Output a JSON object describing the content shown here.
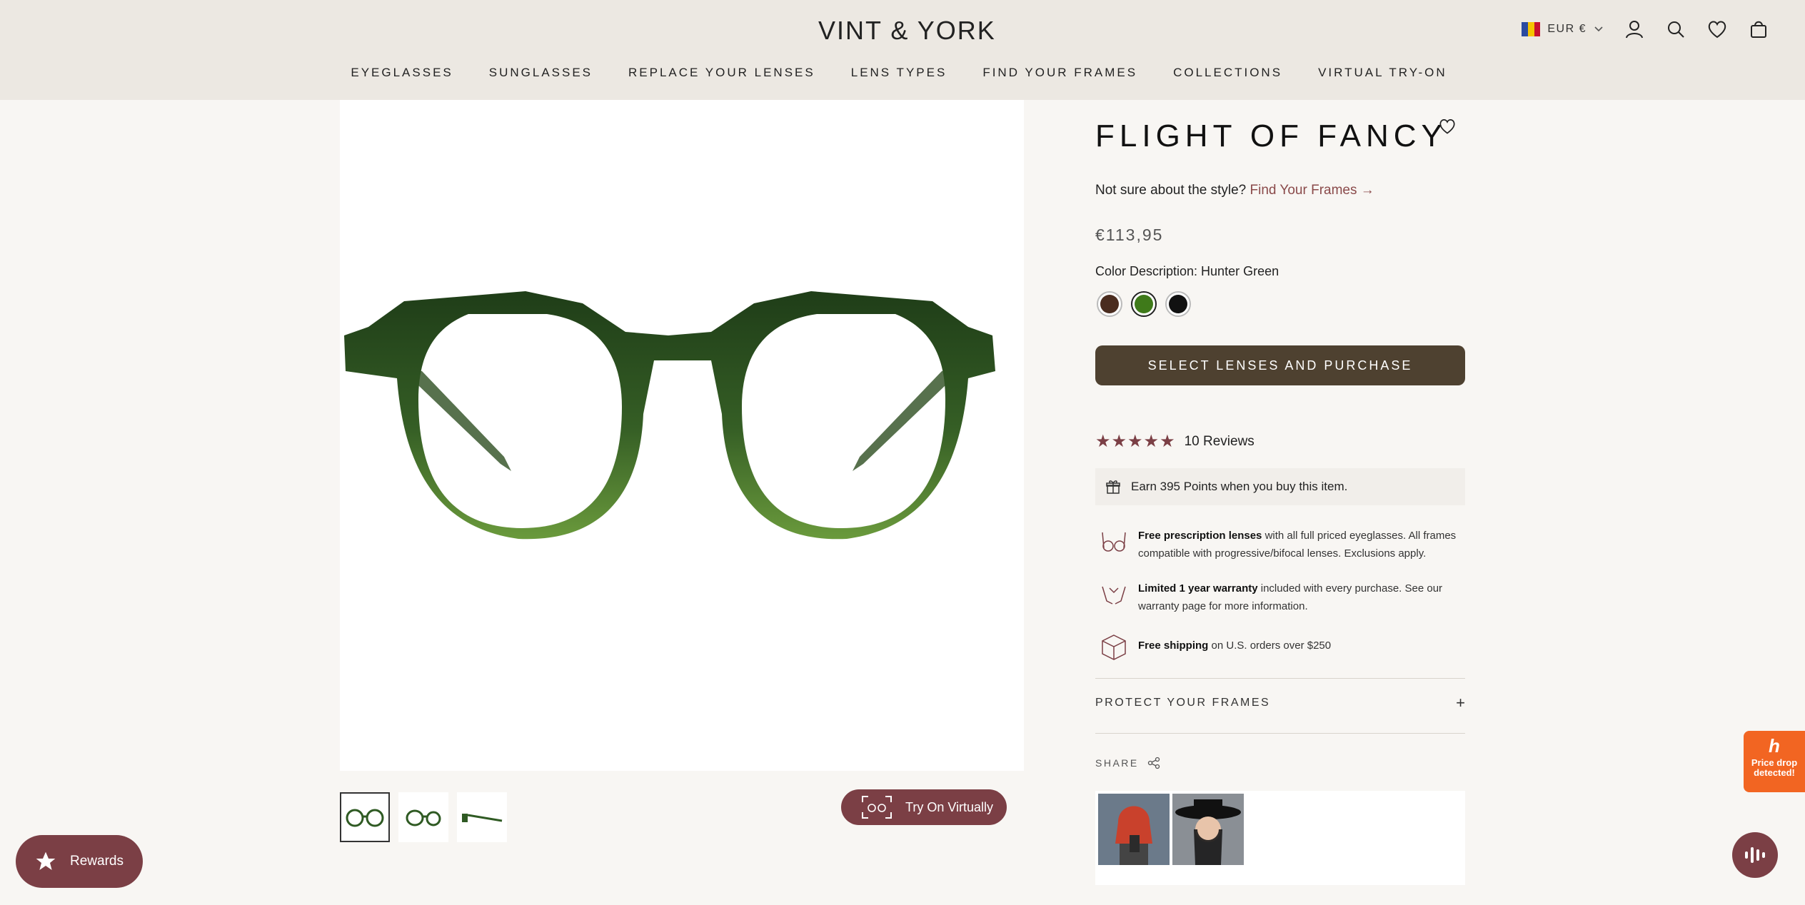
{
  "header": {
    "logo": "VINT & YORK",
    "nav": [
      "EYEGLASSES",
      "SUNGLASSES",
      "REPLACE YOUR LENSES",
      "LENS TYPES",
      "FIND YOUR FRAMES",
      "COLLECTIONS",
      "VIRTUAL TRY-ON"
    ],
    "currency": "EUR €",
    "icons": [
      "account-icon",
      "search-icon",
      "heart-icon",
      "bag-icon"
    ]
  },
  "product": {
    "title": "FLIGHT OF FANCY",
    "style_prompt": "Not sure about the style?",
    "style_link": "Find Your Frames →",
    "price": "€113,95",
    "color_label": "Color Description: Hunter Green",
    "swatch_colors": [
      "#4a2c1f",
      "#3f7a1a",
      "#111111"
    ],
    "selected_swatch": 1,
    "buy_button": "SELECT LENSES AND PURCHASE",
    "rating": 5,
    "reviews": "10 Reviews",
    "points": "Earn 395 Points when you buy this item."
  },
  "benefits": {
    "prescription_bold": "Free prescription lenses",
    "prescription_text": " with all full priced eyeglasses. All frames compatible with progressive/bifocal lenses. Exclusions apply.",
    "warranty_bold": "Limited 1 year warranty",
    "warranty_text": " included with every purchase. See our warranty page for more information.",
    "shipping_bold": "Free shipping",
    "shipping_text": " on U.S. orders over $250"
  },
  "protect_label": "PROTECT YOUR FRAMES",
  "share_label": "SHARE",
  "try_on": "Try On Virtually",
  "rewards": "Rewards",
  "honey": {
    "line1": "Price drop",
    "line2": "detected!"
  },
  "colors": {
    "accent": "#7b3f45",
    "buy": "#4e4130",
    "header_bg": "#ece8e2",
    "frame_green": "#2f5a23"
  }
}
